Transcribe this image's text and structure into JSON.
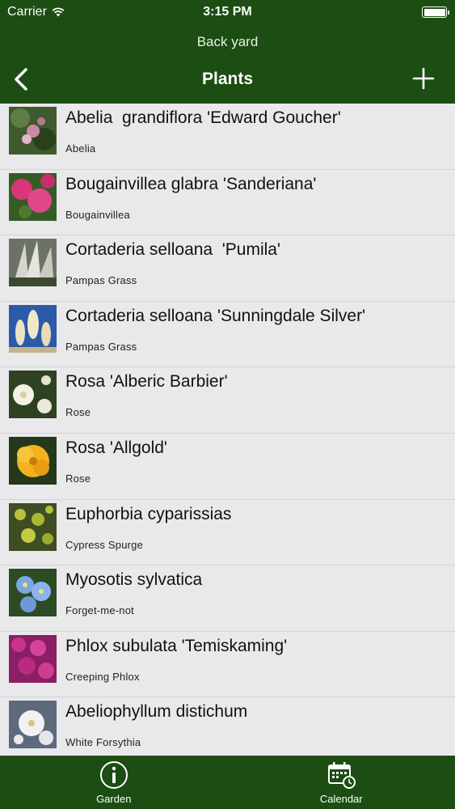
{
  "status_bar": {
    "carrier": "Carrier",
    "time": "3:15 PM"
  },
  "nav": {
    "subtitle": "Back yard",
    "title": "Plants"
  },
  "plants": [
    {
      "name": "Abelia  grandiflora 'Edward Goucher'",
      "common": "Abelia",
      "thumb": "pink-shrub"
    },
    {
      "name": "Bougainvillea glabra 'Sanderiana'",
      "common": "Bougainvillea",
      "thumb": "magenta-bracts"
    },
    {
      "name": "Cortaderia selloana  'Pumila'",
      "common": "Pampas Grass",
      "thumb": "grass-plumes"
    },
    {
      "name": "Cortaderia selloana 'Sunningdale Silver'",
      "common": "Pampas Grass",
      "thumb": "plumes-sky"
    },
    {
      "name": "Rosa 'Alberic Barbier'",
      "common": "Rose",
      "thumb": "white-roses"
    },
    {
      "name": "Rosa 'Allgold'",
      "common": "Rose",
      "thumb": "yellow-rose"
    },
    {
      "name": "Euphorbia cyparissias",
      "common": "Cypress Spurge",
      "thumb": "green-spurge"
    },
    {
      "name": "Myosotis sylvatica",
      "common": "Forget-me-not",
      "thumb": "blue-flowers"
    },
    {
      "name": "Phlox subulata 'Temiskaming'",
      "common": "Creeping Phlox",
      "thumb": "magenta-phlox"
    },
    {
      "name": "Abeliophyllum distichum",
      "common": "White Forsythia",
      "thumb": "white-blossom"
    }
  ],
  "tabs": [
    {
      "label": "Garden",
      "icon": "info-icon"
    },
    {
      "label": "Calendar",
      "icon": "calendar-icon"
    }
  ]
}
